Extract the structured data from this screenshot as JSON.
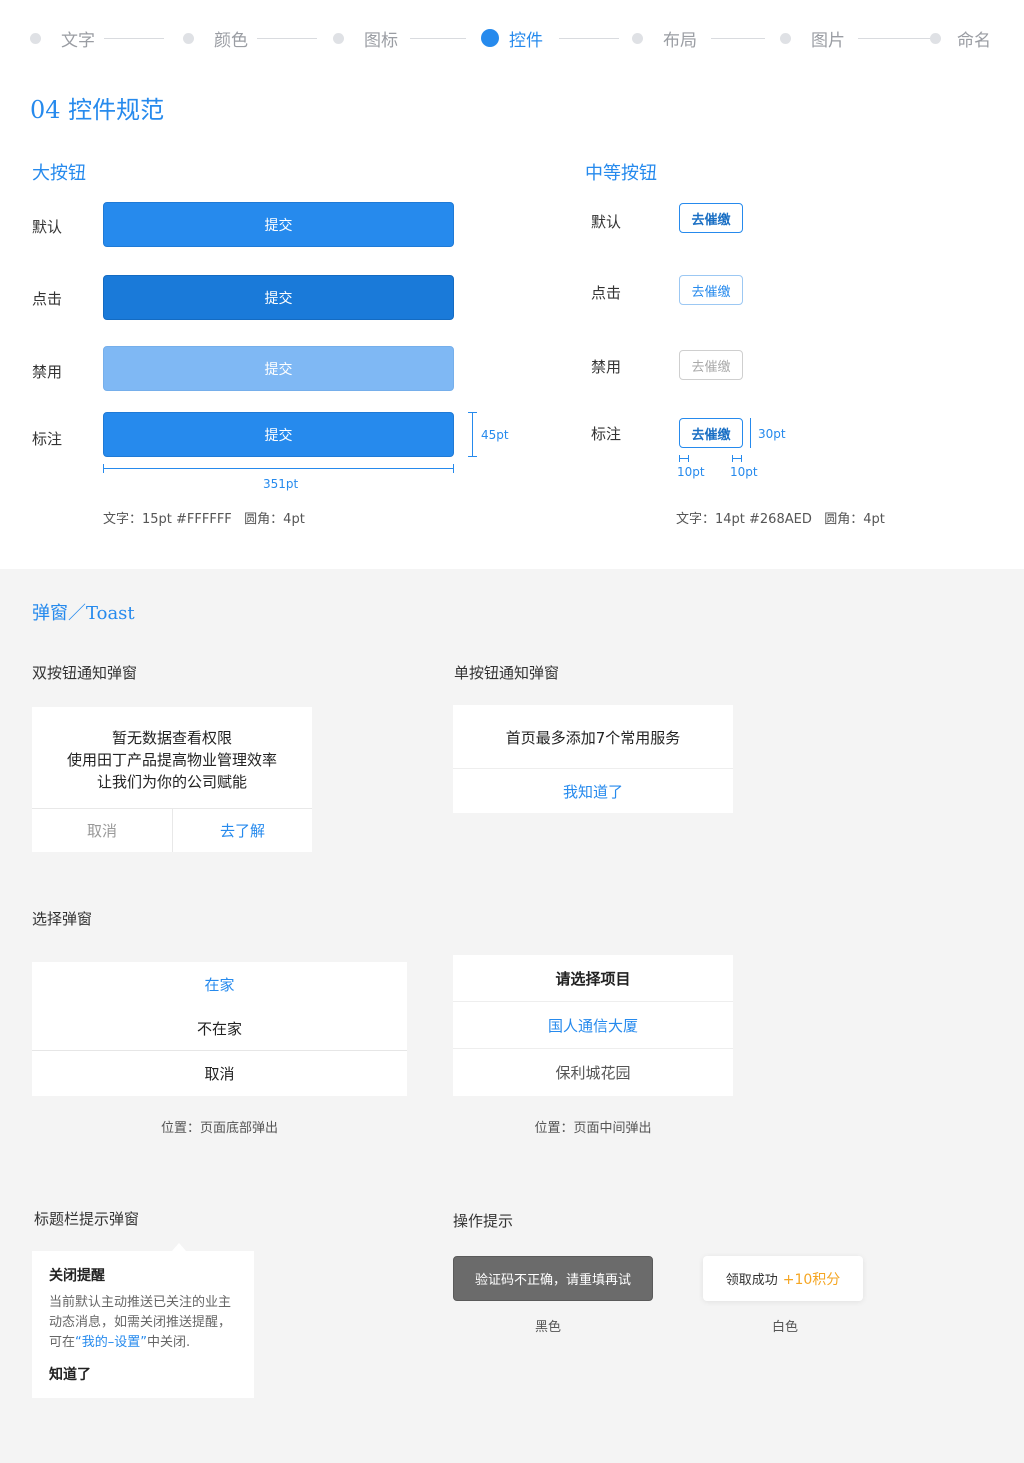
{
  "nav": {
    "items": [
      "文字",
      "颜色",
      "图标",
      "控件",
      "布局",
      "图片",
      "命名"
    ],
    "active_index": 3
  },
  "title": "04 控件规范",
  "large_button": {
    "heading": "大按钮",
    "states": [
      "默认",
      "点击",
      "禁用",
      "标注"
    ],
    "label": "提交",
    "width_note": "351pt",
    "height_note": "45pt",
    "spec": "文字：15pt #FFFFFF   圆角：4pt"
  },
  "medium_button": {
    "heading": "中等按钮",
    "states": [
      "默认",
      "点击",
      "禁用",
      "标注"
    ],
    "label": "去催缴",
    "height_note": "30pt",
    "padding_left": "10pt",
    "padding_right": "10pt",
    "spec": "文字：14pt #268AED   圆角：4pt"
  },
  "popup": {
    "heading": "弹窗／Toast",
    "double": {
      "title": "双按钮通知弹窗",
      "lines": [
        "暂无数据查看权限",
        "使用田丁产品提高物业管理效率",
        "让我们为你的公司赋能"
      ],
      "cancel": "取消",
      "confirm": "去了解"
    },
    "single": {
      "title": "单按钮通知弹窗",
      "message": "首页最多添加7个常用服务",
      "button": "我知道了"
    },
    "select_title": "选择弹窗",
    "bottom_sheet": {
      "options": [
        "在家",
        "不在家"
      ],
      "cancel": "取消",
      "caption": "位置：页面底部弹出"
    },
    "center_select": {
      "header": "请选择项目",
      "options": [
        "国人通信大厦",
        "保利城花园"
      ],
      "caption": "位置：页面中间弹出"
    },
    "titlebar": {
      "title": "标题栏提示弹窗",
      "card_title": "关闭提醒",
      "body_pre": "当前默认主动推送已关注的业主动态消息，如需关闭推送提醒，可在",
      "body_link": "“我的–设置”",
      "body_post": "中关闭.",
      "ok": "知道了"
    },
    "toast": {
      "title": "操作提示",
      "black_text": "验证码不正确，请重填再试",
      "black_caption": "黑色",
      "white_text": "领取成功",
      "white_highlight": "+10积分",
      "white_caption": "白色"
    }
  },
  "colors": {
    "primary": "#268AED",
    "pressed": "#1A7AD9",
    "disabled": "#7FB8F4",
    "highlight": "#F5A623",
    "toast_dark": "#6B6B6B"
  }
}
